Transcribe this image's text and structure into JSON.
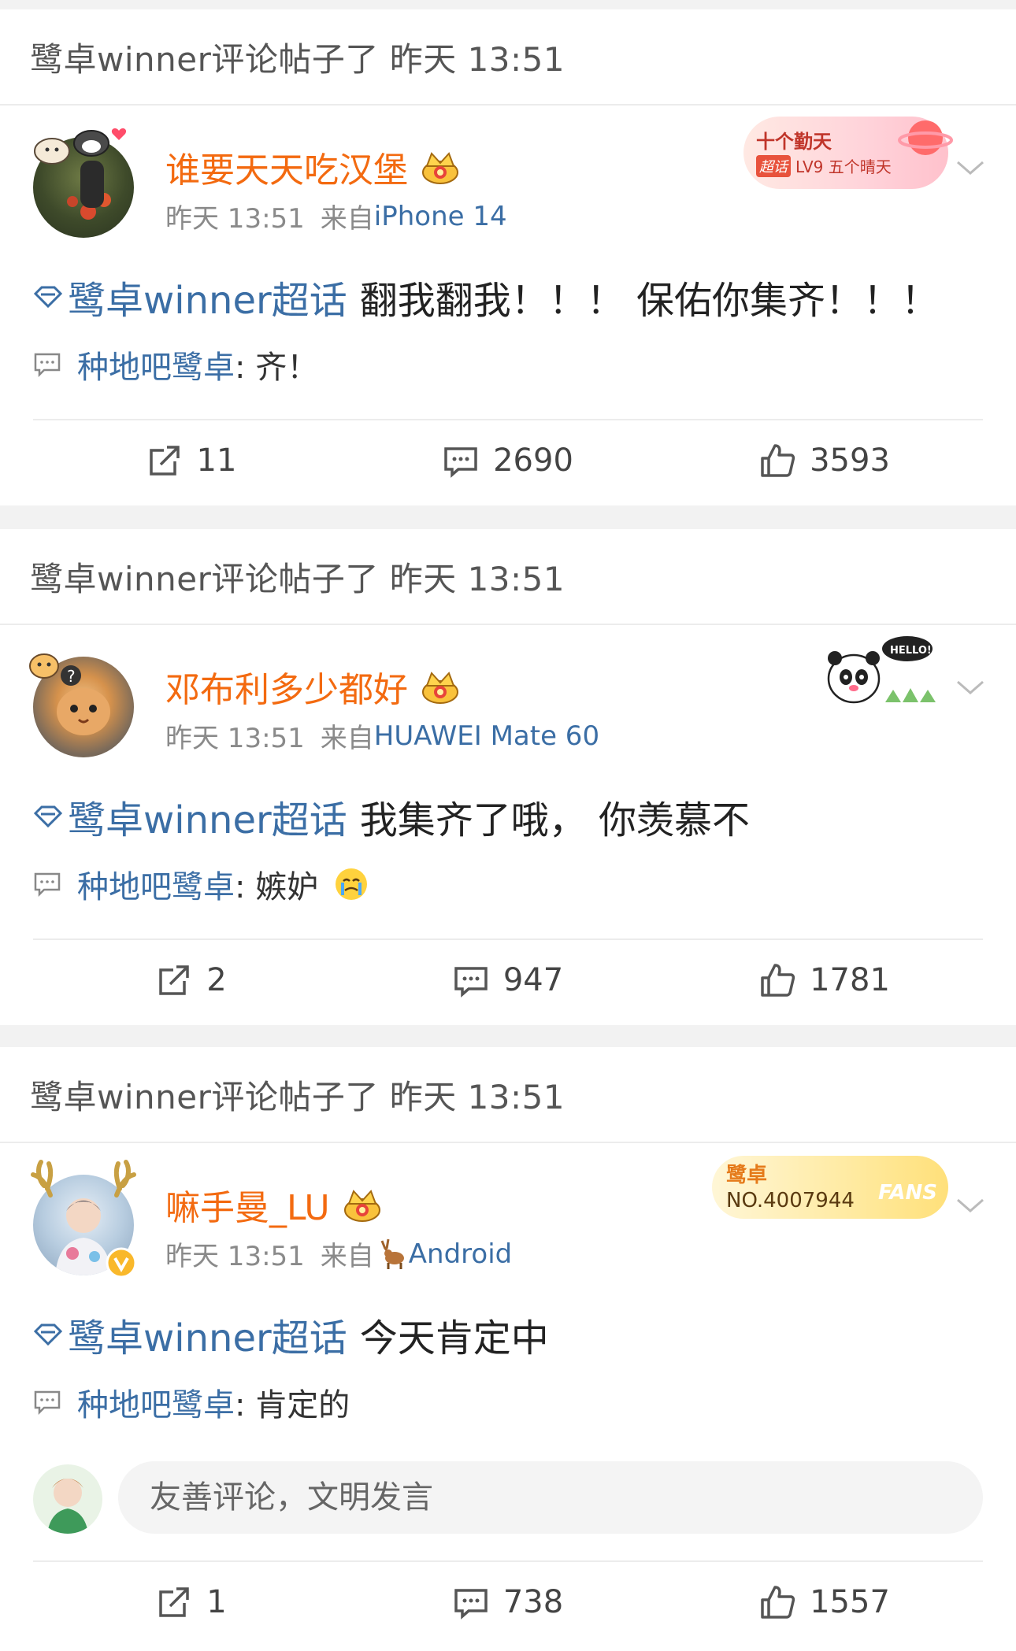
{
  "posts": [
    {
      "header": "鹭卓winner评论帖子了 昨天 13:51",
      "username": "谁要天天吃汉堡",
      "time": "昨天 13:51",
      "from_prefix": "来自",
      "source": "iPhone 14",
      "badge": {
        "line1": "十个勤天",
        "tag": "超话",
        "line2": "LV9 五个晴天"
      },
      "topic": "鹭卓winner超话",
      "text": "翻我翻我！！！ 保佑你集齐！！！",
      "reply_user": "种地吧鹭卓",
      "reply_text": ": 齐！",
      "reposts": "11",
      "comments": "2690",
      "likes": "3593"
    },
    {
      "header": "鹭卓winner评论帖子了 昨天 13:51",
      "username": "邓布利多少都好",
      "time": "昨天 13:51",
      "from_prefix": "来自",
      "source": "HUAWEI Mate 60",
      "badge": {
        "hello": "HELLO!"
      },
      "topic": "鹭卓winner超话",
      "text": "我集齐了哦， 你羡慕不",
      "reply_user": "种地吧鹭卓",
      "reply_text": ": 嫉妒",
      "reposts": "2",
      "comments": "947",
      "likes": "1781"
    },
    {
      "header": "鹭卓winner评论帖子了 昨天 13:51",
      "username": "嘛手曼_LU",
      "time": "昨天 13:51",
      "from_prefix": "来自",
      "source": "Android",
      "badge": {
        "line1": "鹭卓",
        "line2": "NO.4007944",
        "fans": "FANS"
      },
      "topic": "鹭卓winner超话",
      "text": "今天肯定中",
      "reply_user": "种地吧鹭卓",
      "reply_text": ": 肯定的",
      "comment_placeholder": "友善评论，文明发言",
      "reposts": "1",
      "comments": "738",
      "likes": "1557"
    }
  ],
  "colors": {
    "username": "#f36a10",
    "link": "#3b6ea5",
    "background": "#f2f2f2"
  },
  "icons": [
    "repost-icon",
    "comment-icon",
    "like-icon",
    "chevron-down-icon",
    "crown-icon",
    "topic-diamond-icon",
    "reply-bubble-icon"
  ]
}
